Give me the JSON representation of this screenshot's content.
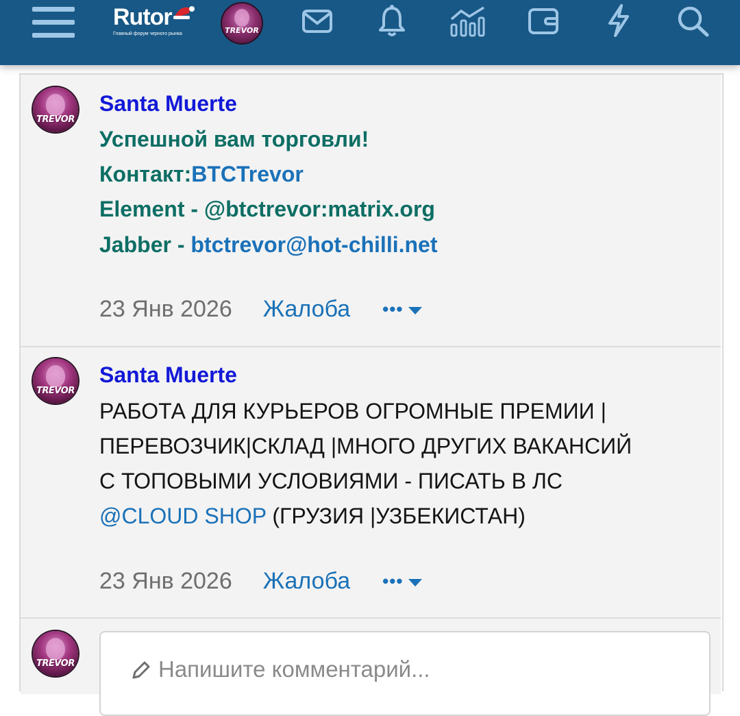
{
  "header": {
    "logo_text": "Rutor",
    "logo_subtitle": "Главный форум черного рынка",
    "user_avatar_text": "TREVOR"
  },
  "posts": [
    {
      "author": "Santa Muerte",
      "avatar_text": "TREVOR",
      "lines": {
        "l1": "Успешной вам торговли!",
        "l2_prefix": "Контакт:",
        "l2_link": "BTCTrevor",
        "l3": "Element - @btctrevor:matrix.org",
        "l4_prefix": "Jabber - ",
        "l4_link": "btctrevor@hot-chilli.net"
      },
      "date": "23 Янв 2026",
      "report_label": "Жалоба",
      "more_label": "•••"
    },
    {
      "author": "Santa Muerte",
      "avatar_text": "TREVOR",
      "lines": {
        "l1": "РАБОТА ДЛЯ КУРЬЕРОВ ОГРОМНЫЕ ПРЕМИИ |",
        "l2": "ПЕРЕВОЗЧИК|СКЛАД |МНОГО ДРУГИХ ВАКАНСИЙ",
        "l3": "С ТОПОВЫМИ УСЛОВИЯМИ - ПИСАТЬ В ЛС",
        "l4_link": "@CLOUD SHOP",
        "l4_suffix": " (ГРУЗИЯ |УЗБЕКИСТАН)"
      },
      "date": "23 Янв 2026",
      "report_label": "Жалоба",
      "more_label": "•••"
    }
  ],
  "comment": {
    "avatar_text": "TREVOR",
    "placeholder": "Напишите комментарий..."
  },
  "colors": {
    "header_bg": "#185886",
    "author": "#1219d6",
    "green_text": "#0d6e64",
    "link": "#1a71b8"
  }
}
